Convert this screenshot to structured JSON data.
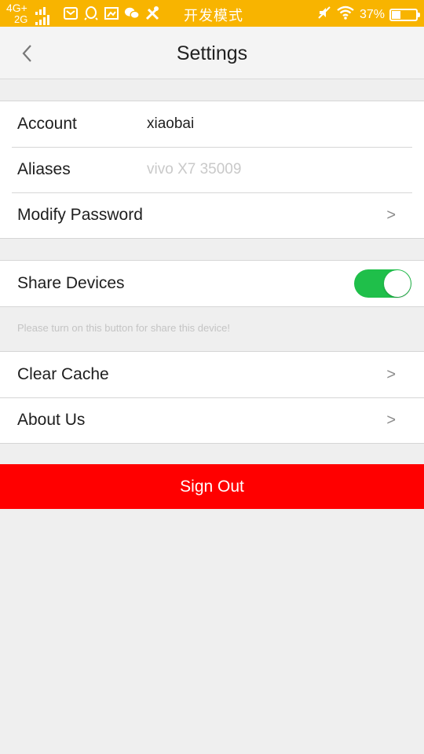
{
  "status_bar": {
    "network_top": "4G+",
    "network_bottom": "2G",
    "mode_text": "开发模式",
    "battery_percent": "37%",
    "battery_level": 0.37,
    "icons": [
      "mail-icon",
      "qq-icon",
      "image-icon",
      "wechat-icon",
      "tools-icon"
    ]
  },
  "header": {
    "title": "Settings"
  },
  "account_group": {
    "account_label": "Account",
    "account_value": "xiaobai",
    "aliases_label": "Aliases",
    "aliases_placeholder": "vivo X7 35009",
    "modify_password_label": "Modify Password",
    "chevron": ">"
  },
  "share_group": {
    "share_devices_label": "Share Devices",
    "share_devices_on": true,
    "hint": "Please turn on this button for share this device!"
  },
  "misc_group": {
    "clear_cache_label": "Clear Cache",
    "about_us_label": "About Us",
    "chevron": ">"
  },
  "sign_out": {
    "label": "Sign Out"
  },
  "colors": {
    "status_bar": "#f8b400",
    "toggle_on": "#1fbf4a",
    "sign_out": "#ff0000"
  }
}
